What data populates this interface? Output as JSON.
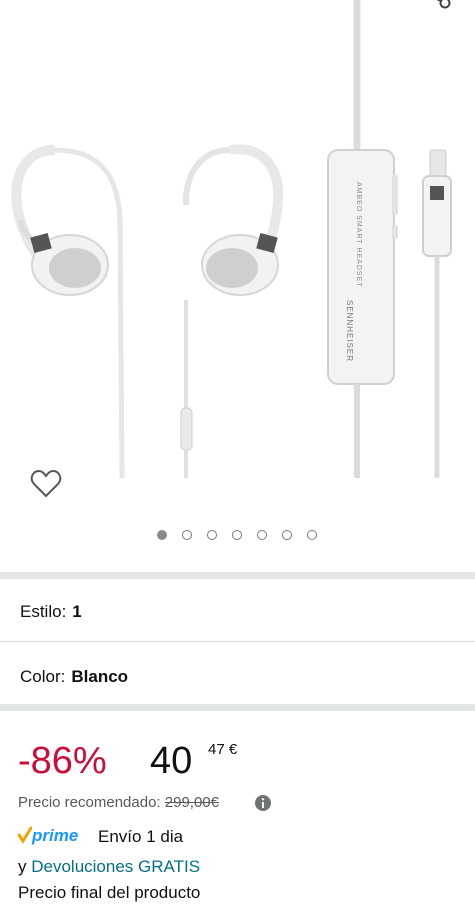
{
  "gallery": {
    "image_alt": "Sennheiser Ambeo Smart Headset",
    "remote_text_1": "SENNHEISER",
    "remote_text_2": "AMBEO SMART HEADSET",
    "image_count": 7,
    "active_index": 0
  },
  "options": {
    "style_label": "Estilo:",
    "style_value": "1",
    "color_label": "Color:",
    "color_value": "Blanco"
  },
  "pricing": {
    "discount": "-86%",
    "price_whole": "40",
    "price_fraction": "47",
    "currency": "€",
    "list_price_label": "Precio recomendado:",
    "list_price": "299,00€"
  },
  "delivery": {
    "prime_label": "prime",
    "shipping": "Envío 1 dia",
    "returns_prefix": "y",
    "returns_link": "Devoluciones GRATIS",
    "final_price_note": "Precio final del producto"
  },
  "colors": {
    "discount": "#cc0c39",
    "link": "#007185",
    "prime_check": "#f0a400",
    "prime_text": "#1a98ff"
  }
}
